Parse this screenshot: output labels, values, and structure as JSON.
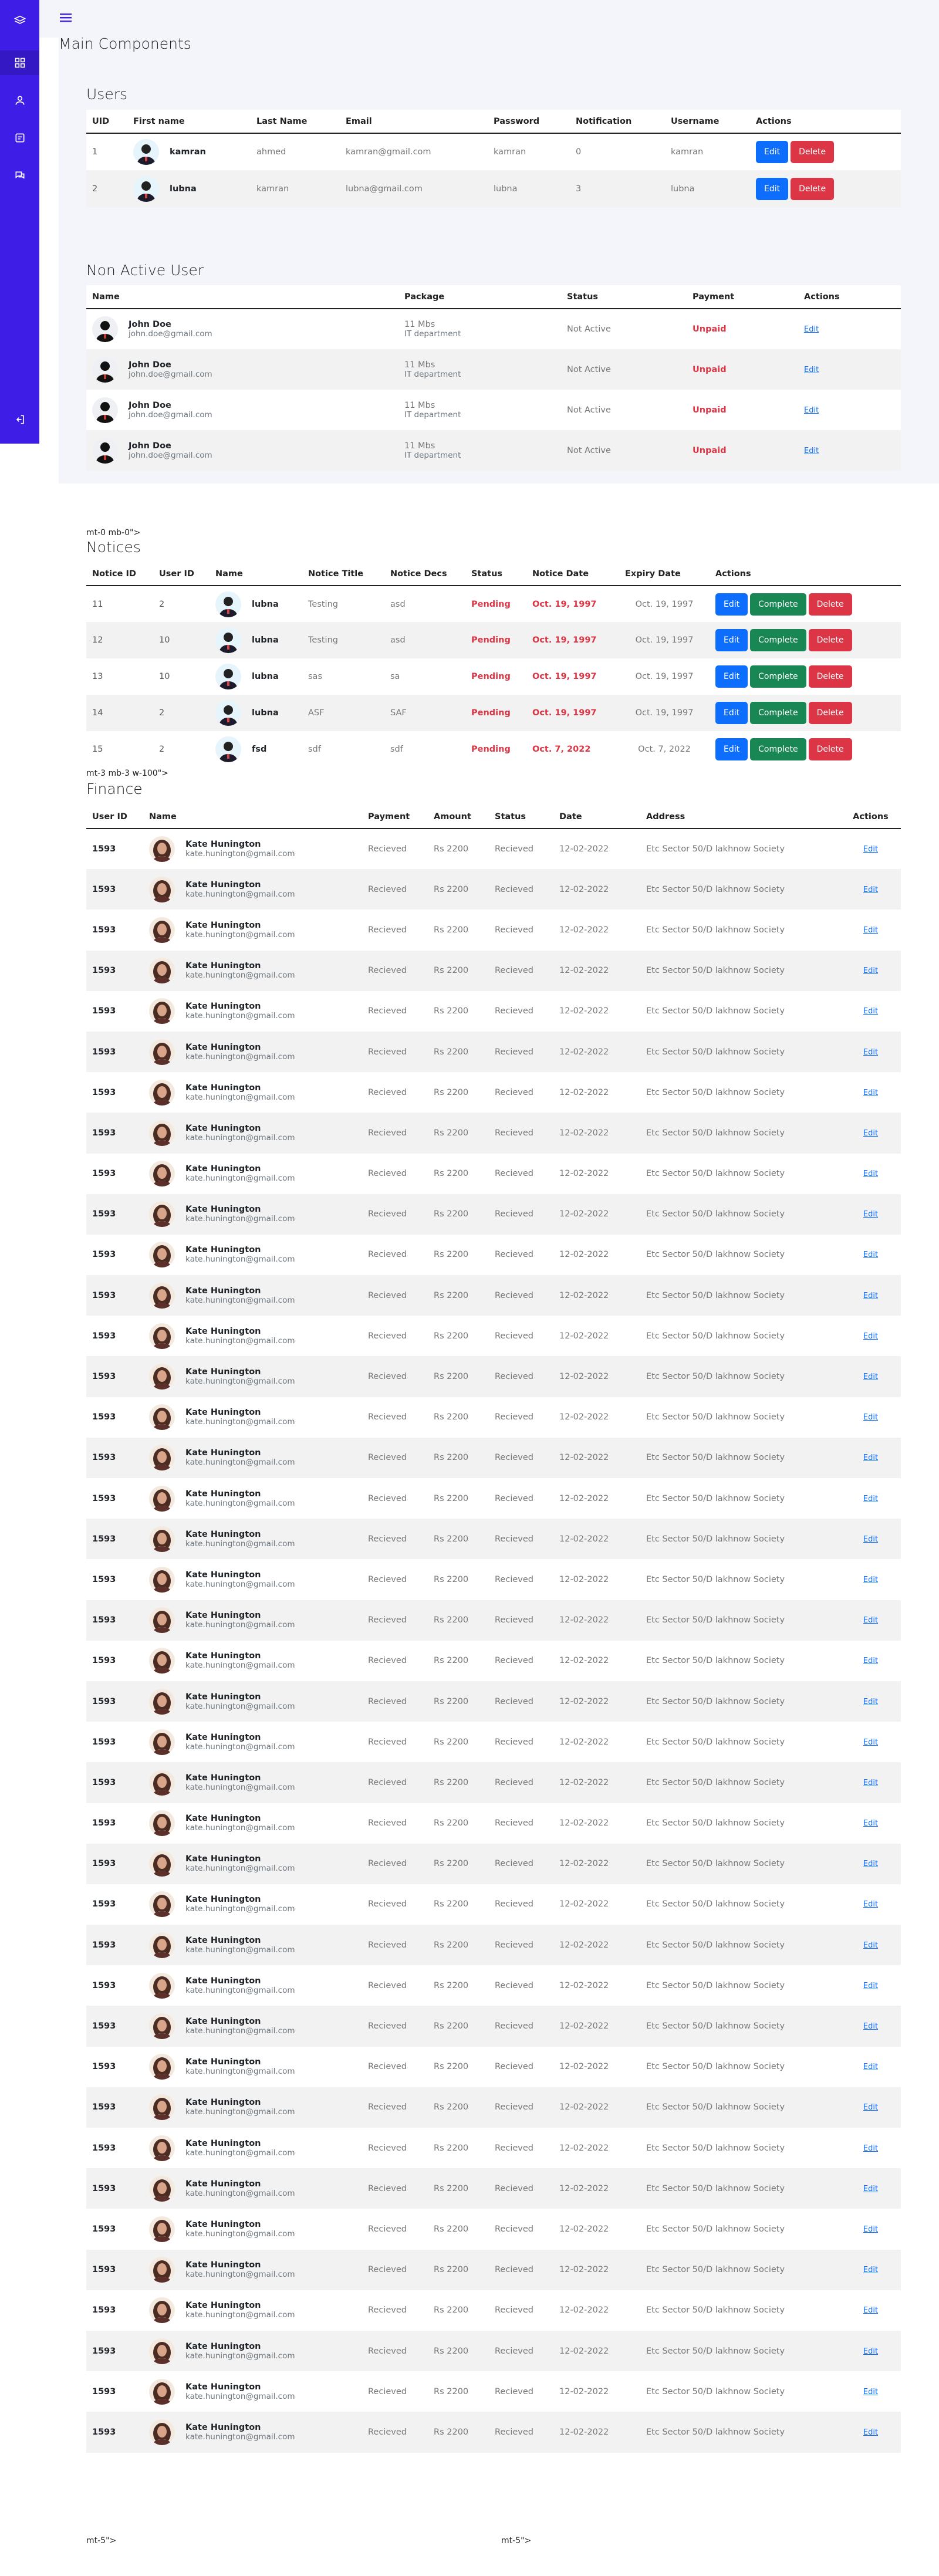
{
  "header": {
    "title": "Main Components"
  },
  "sidebar": {
    "icons": [
      "layers-icon",
      "grid-icon",
      "user-icon",
      "clipboard-icon",
      "chat-icon",
      "logout-icon"
    ]
  },
  "users": {
    "title": "Users",
    "columns": [
      "UID",
      "First name",
      "Last Name",
      "Email",
      "Password",
      "Notification",
      "Username",
      "Actions"
    ],
    "rows": [
      {
        "uid": "1",
        "first": "kamran",
        "last": "ahmed",
        "email": "kamran@gmail.com",
        "password": "kamran",
        "notification": "0",
        "username": "kamran"
      },
      {
        "uid": "2",
        "first": "lubna",
        "last": "kamran",
        "email": "lubna@gmail.com",
        "password": "lubna",
        "notification": "3",
        "username": "lubna"
      }
    ],
    "edit_label": "Edit",
    "delete_label": "Delete"
  },
  "inactive": {
    "title": "Non Active User",
    "columns": [
      "Name",
      "Package",
      "Status",
      "Payment",
      "Actions"
    ],
    "rows": [
      {
        "name": "John Doe",
        "email": "john.doe@gmail.com",
        "package": "11 Mbs",
        "dept": "IT department",
        "status": "Not Active",
        "payment": "Unpaid",
        "action": "Edit"
      },
      {
        "name": "John Doe",
        "email": "john.doe@gmail.com",
        "package": "11 Mbs",
        "dept": "IT department",
        "status": "Not Active",
        "payment": "Unpaid",
        "action": "Edit"
      },
      {
        "name": "John Doe",
        "email": "john.doe@gmail.com",
        "package": "11 Mbs",
        "dept": "IT department",
        "status": "Not Active",
        "payment": "Unpaid",
        "action": "Edit"
      },
      {
        "name": "John Doe",
        "email": "john.doe@gmail.com",
        "package": "11 Mbs",
        "dept": "IT department",
        "status": "Not Active",
        "payment": "Unpaid",
        "action": "Edit"
      }
    ]
  },
  "stray1": "mt-0 mb-0\">",
  "notices": {
    "title": "Notices",
    "columns": [
      "Notice ID",
      "User ID",
      "Name",
      "Notice Title",
      "Notice Decs",
      "Status",
      "Notice Date",
      "Expiry Date",
      "Actions"
    ],
    "rows": [
      {
        "nid": "11",
        "uid": "2",
        "name": "lubna",
        "ntitle": "Testing",
        "desc": "asd",
        "status": "Pending",
        "date": "Oct. 19, 1997",
        "expiry": "Oct. 19, 1997"
      },
      {
        "nid": "12",
        "uid": "10",
        "name": "lubna",
        "ntitle": "Testing",
        "desc": "asd",
        "status": "Pending",
        "date": "Oct. 19, 1997",
        "expiry": "Oct. 19, 1997"
      },
      {
        "nid": "13",
        "uid": "10",
        "name": "lubna",
        "ntitle": "sas",
        "desc": "sa",
        "status": "Pending",
        "date": "Oct. 19, 1997",
        "expiry": "Oct. 19, 1997"
      },
      {
        "nid": "14",
        "uid": "2",
        "name": "lubna",
        "ntitle": "ASF",
        "desc": "SAF",
        "status": "Pending",
        "date": "Oct. 19, 1997",
        "expiry": "Oct. 19, 1997"
      },
      {
        "nid": "15",
        "uid": "2",
        "name": "fsd",
        "ntitle": "sdf",
        "desc": "sdf",
        "status": "Pending",
        "date": "Oct. 7, 2022",
        "expiry": "Oct. 7, 2022"
      }
    ],
    "edit_label": "Edit",
    "complete_label": "Complete",
    "delete_label": "Delete"
  },
  "stray2": "mt-3 mb-3 w-100\">",
  "finance": {
    "title": "Finance",
    "columns": [
      "User ID",
      "Name",
      "Payment",
      "Amount",
      "Status",
      "Date",
      "Address",
      "Actions"
    ],
    "row": {
      "uid": "1593",
      "name": "Kate Hunington",
      "email": "kate.hunington@gmail.com",
      "payment": "Recieved",
      "amount": "Rs 2200",
      "status": "Recieved",
      "date": "12-02-2022",
      "address": "Etc Sector 50/D lakhnow Society",
      "action": "Edit"
    },
    "row_count": 40
  },
  "footer": {
    "left": "mt-5\">",
    "right": "mt-5\">"
  }
}
